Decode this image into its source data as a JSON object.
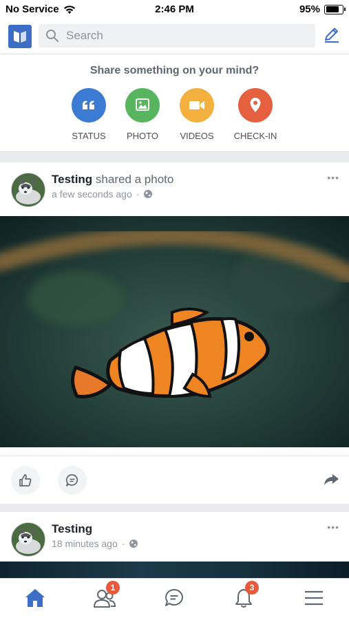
{
  "status_bar": {
    "carrier": "No Service",
    "time": "2:46 PM",
    "battery": "95%",
    "battery_level": 0.95
  },
  "search": {
    "placeholder": "Search"
  },
  "composer": {
    "prompt": "Share something on your mind?",
    "actions": [
      {
        "label": "STATUS",
        "color": "#3b7bd4",
        "icon": "quote-icon"
      },
      {
        "label": "PHOTO",
        "color": "#56b55e",
        "icon": "photo-icon"
      },
      {
        "label": "VIDEOS",
        "color": "#f4b03f",
        "icon": "video-camera-icon"
      },
      {
        "label": "CHECK-IN",
        "color": "#e5603f",
        "icon": "location-pin-icon"
      }
    ]
  },
  "posts": [
    {
      "author": "Testing",
      "action": "shared a photo",
      "time": "a few seconds ago",
      "separator": "·"
    },
    {
      "author": "Testing",
      "action": "",
      "time": "18 minutes ago",
      "separator": "·"
    }
  ],
  "tabbar": {
    "friends_badge": "1",
    "notifications_badge": "3",
    "active_color": "#3b6ec4"
  }
}
